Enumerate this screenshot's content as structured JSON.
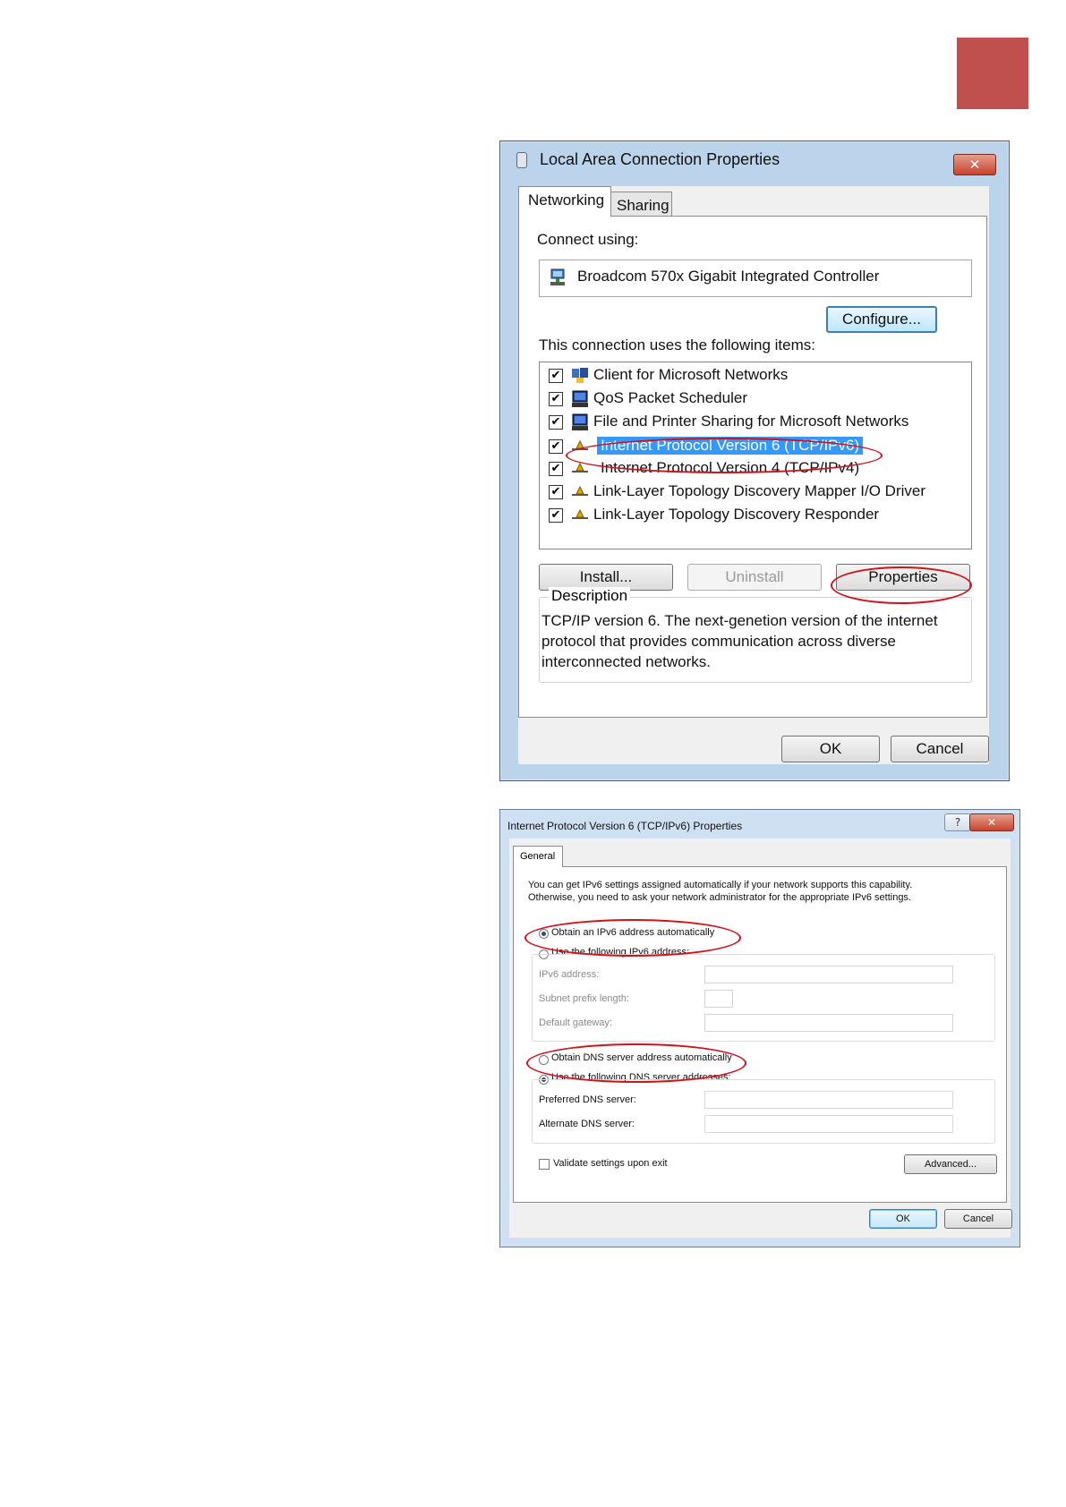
{
  "lan_dialog": {
    "title": "Local Area Connection Properties",
    "close_glyph": "✕",
    "tabs": [
      "Networking",
      "Sharing"
    ],
    "connect_using_label": "Connect using:",
    "adapter_name": "Broadcom 570x Gigabit Integrated Controller",
    "configure_label": "Configure...",
    "items_label": "This connection uses the following items:",
    "items": [
      {
        "label": "Client for Microsoft Networks",
        "checked": true,
        "icon": "client-icon"
      },
      {
        "label": "QoS Packet Scheduler",
        "checked": true,
        "icon": "computer-icon"
      },
      {
        "label": "File and Printer Sharing for Microsoft Networks",
        "checked": true,
        "icon": "computer-icon"
      },
      {
        "label": "Internet Protocol Version 6 (TCP/IPv6)",
        "checked": true,
        "selected": true,
        "icon": "protocol-icon"
      },
      {
        "label": "Internet Protocol Version 4 (TCP/IPv4)",
        "checked": true,
        "icon": "protocol-icon"
      },
      {
        "label": "Link-Layer Topology Discovery Mapper I/O Driver",
        "checked": true,
        "icon": "protocol-icon"
      },
      {
        "label": "Link-Layer Topology Discovery Responder",
        "checked": true,
        "icon": "protocol-icon"
      }
    ],
    "install_label": "Install...",
    "uninstall_label": "Uninstall",
    "properties_label": "Properties",
    "description_label": "Description",
    "description_text": "TCP/IP version 6. The next-genetion version of the internet protocol that provides communication across diverse interconnected networks.",
    "ok_label": "OK",
    "cancel_label": "Cancel"
  },
  "ipv6_dialog": {
    "title": "Internet Protocol Version 6 (TCP/IPv6) Properties",
    "help_glyph": "?",
    "close_glyph": "✕",
    "tab": "General",
    "intro_line1": "You can get IPv6 settings assigned automatically if your network supports this capability.",
    "intro_line2": "Otherwise, you need to ask your network administrator for the appropriate IPv6 settings.",
    "auto_address_label": "Obtain an IPv6 address automatically",
    "manual_address_label": "Use the following IPv6 address:",
    "ipv6_address_label": "IPv6 address:",
    "subnet_prefix_label": "Subnet prefix length:",
    "default_gateway_label": "Default gateway:",
    "auto_dns_label": "Obtain DNS server address automatically",
    "manual_dns_label": "Use the following DNS server addresses:",
    "preferred_dns_label": "Preferred DNS server:",
    "alternate_dns_label": "Alternate DNS server:",
    "validate_label": "Validate settings upon exit",
    "advanced_label": "Advanced...",
    "ok_label": "OK",
    "cancel_label": "Cancel"
  },
  "colors": {
    "page_tab": "#c0504d",
    "annotation_ring": "#d0121b",
    "selection": "#3399ff"
  }
}
